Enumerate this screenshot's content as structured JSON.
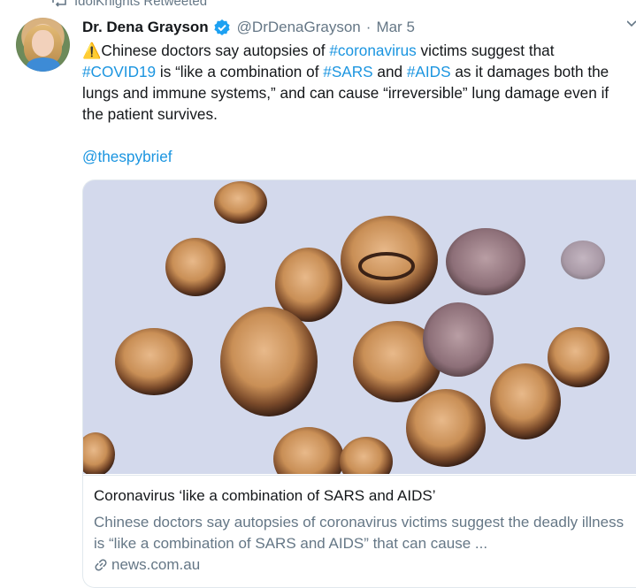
{
  "retweet": {
    "label": "IdolKnights Retweeted"
  },
  "tweet": {
    "name": "Dr. Dena Grayson",
    "handle": "@DrDenaGrayson",
    "separator": "·",
    "date": "Mar 5",
    "warning_emoji": "⚠️",
    "text_segments": {
      "s1": "Chinese doctors say autopsies of ",
      "tag1": "#coronavirus",
      "s2": " victims suggest that ",
      "tag2": "#COVID19",
      "s3": " is “like a combination of ",
      "tag3": "#SARS",
      "s4": " and ",
      "tag4": "#AIDS",
      "s5": " as it damages both the lungs and immune systems,” and can cause “irreversible” lung damage even if the patient survives."
    },
    "mention": "@thespybrief"
  },
  "card": {
    "title": "Coronavirus ‘like a combination of SARS and AIDS’",
    "description": "Chinese doctors say autopsies of coronavirus victims suggest the deadly illness is “like a combination of SARS and AIDS” that can cause ...",
    "domain": "news.com.au"
  },
  "colors": {
    "link_blue": "#1b95e0",
    "secondary_gray": "#657786",
    "text_dark": "#14171a",
    "border": "#e1e8ed"
  },
  "icons": {
    "retweet": "retweet-icon",
    "verified": "verified-badge-icon",
    "link": "link-icon",
    "overflow": "chevron-down-icon"
  }
}
